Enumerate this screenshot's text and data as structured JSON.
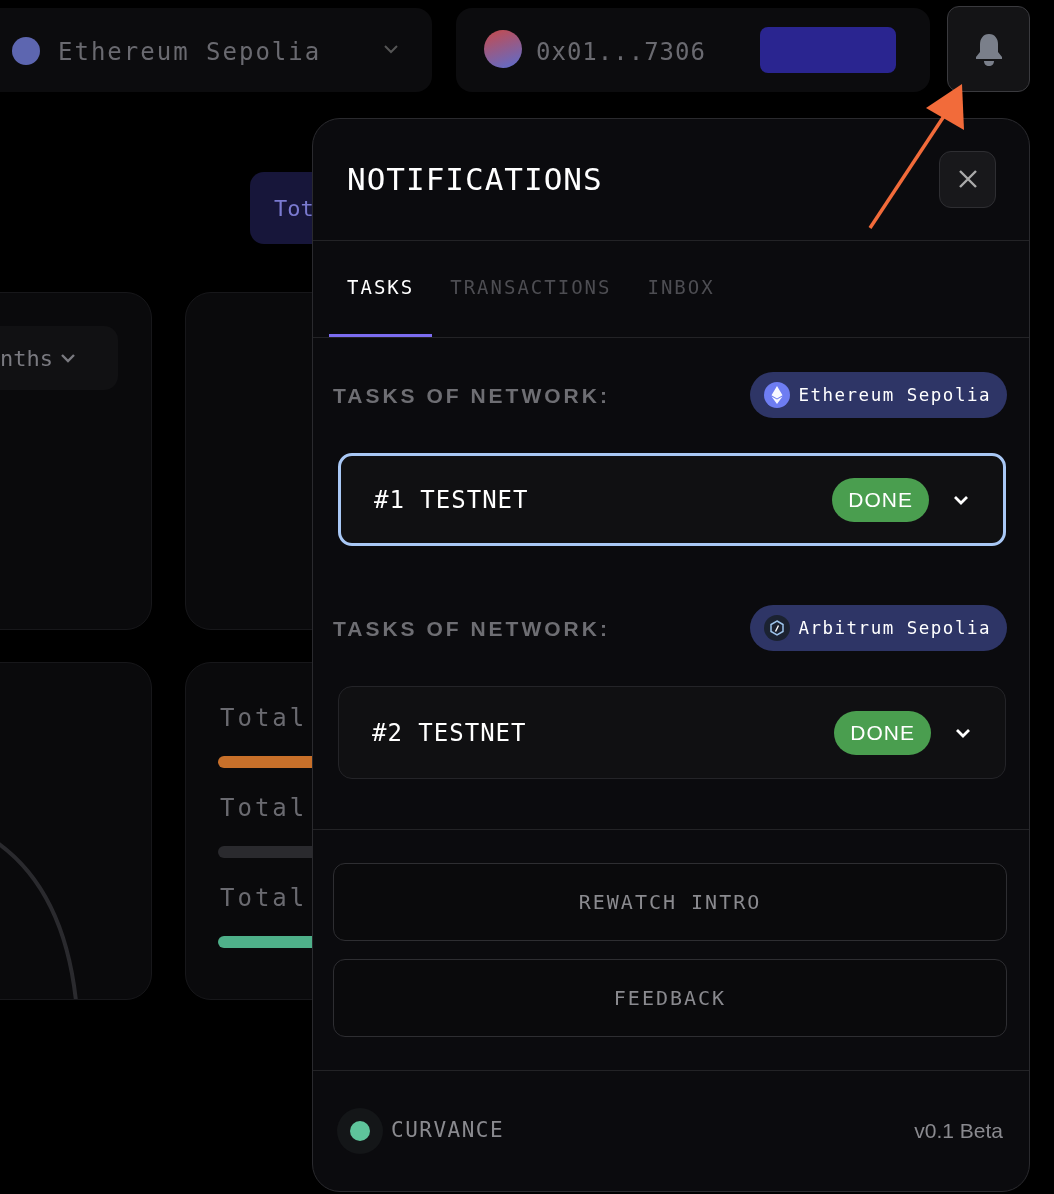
{
  "top_bar": {
    "network": "Ethereum Sepolia",
    "wallet": "0x01...7306"
  },
  "background": {
    "button": "Tot",
    "dropdown": "nths",
    "stat_rows": [
      {
        "label": "Total",
        "color": "#c8702a"
      },
      {
        "label": "Total",
        "color": "#2a2a2e"
      },
      {
        "label": "Total",
        "color": "#4fb08a"
      }
    ]
  },
  "notifications": {
    "title": "NOTIFICATIONS",
    "tabs": [
      {
        "label": "TASKS",
        "selected": true
      },
      {
        "label": "TRANSACTIONS",
        "selected": false
      },
      {
        "label": "INBOX",
        "selected": false
      }
    ],
    "sections": [
      {
        "heading": "TASKS OF NETWORK:",
        "network": "Ethereum Sepolia",
        "kind": "ethereum",
        "tasks": [
          {
            "title": "#1 TESTNET",
            "status": "DONE",
            "selected": true
          }
        ]
      },
      {
        "heading": "TASKS OF NETWORK:",
        "network": "Arbitrum Sepolia",
        "kind": "arbitrum",
        "tasks": [
          {
            "title": "#2 TESTNET",
            "status": "DONE",
            "selected": false
          }
        ]
      }
    ],
    "buttons": [
      "REWATCH INTRO",
      "FEEDBACK"
    ],
    "footer": {
      "brand": "CURVANCE",
      "version": "v0.1 Beta"
    }
  }
}
